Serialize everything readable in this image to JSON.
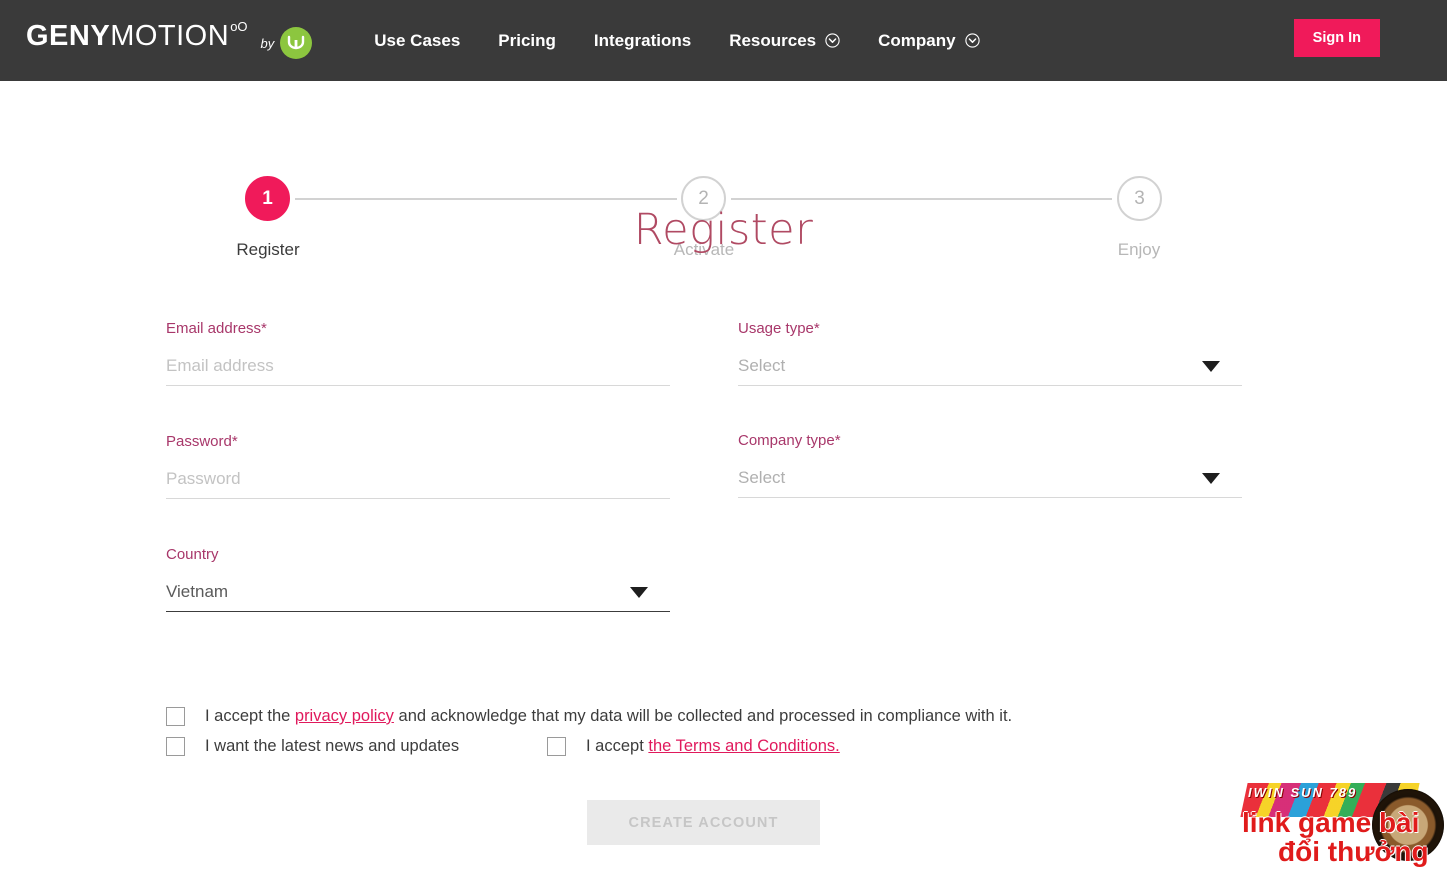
{
  "brand": {
    "logo_bold": "GENY",
    "logo_light": "MOTION",
    "logo_superscript": "oO",
    "by_text": "by",
    "by_logo_icon": "genymobile-bull-logo",
    "accent_pink": "#f01a5a",
    "label_pink": "#a8376a",
    "title_pink": "#b04a63",
    "link_pink": "#e0195c",
    "green": "#8cc63f",
    "header_bg": "#3a3a3a"
  },
  "nav": {
    "items": [
      {
        "label": "Use Cases",
        "has_caret": false
      },
      {
        "label": "Pricing",
        "has_caret": false
      },
      {
        "label": "Integrations",
        "has_caret": false
      },
      {
        "label": "Resources",
        "has_caret": true
      },
      {
        "label": "Company",
        "has_caret": true
      }
    ],
    "sign_in_label": "Sign In"
  },
  "stepper": {
    "steps": [
      {
        "number": "1",
        "label": "Register",
        "state": "active"
      },
      {
        "number": "2",
        "label": "Activate",
        "state": "inactive"
      },
      {
        "number": "3",
        "label": "Enjoy",
        "state": "inactive"
      }
    ]
  },
  "page": {
    "title": "Register"
  },
  "form": {
    "email": {
      "label": "Email address*",
      "placeholder": "Email address",
      "value": ""
    },
    "password": {
      "label": "Password*",
      "placeholder": "Password",
      "value": ""
    },
    "country": {
      "label": "Country",
      "value": "Vietnam"
    },
    "usage_type": {
      "label": "Usage type*",
      "value": "Select"
    },
    "company_type": {
      "label": "Company type*",
      "value": "Select"
    }
  },
  "consents": {
    "privacy": {
      "text_before": "I accept the ",
      "link": "privacy policy",
      "text_after": " and acknowledge that my data will be collected and processed in compliance with it.",
      "checked": false
    },
    "news": {
      "text": "I want the latest news and updates",
      "checked": false
    },
    "terms": {
      "text_before": "I accept ",
      "link": "the Terms and Conditions.",
      "checked": false
    }
  },
  "submit": {
    "label": "CREATE ACCOUNT",
    "disabled": true
  },
  "watermark": {
    "banner_text": "IWIN SUN 789",
    "line1": "link game bài",
    "line2": "đổi thưởng",
    "wheel_icon": "roulette-wheel-icon"
  }
}
